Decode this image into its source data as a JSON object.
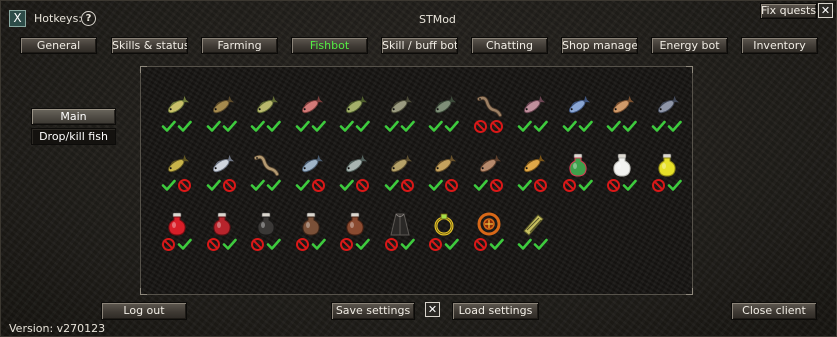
{
  "window": {
    "close_glyph": "X",
    "hotkeys_label": "Hotkeys:",
    "help_glyph": "?",
    "title": "STMod",
    "fix_quests_label": "Fix quests:",
    "fix_quests_close_glyph": "✕"
  },
  "tabs": [
    {
      "label": "General",
      "active": false
    },
    {
      "label": "Skills & status",
      "active": false
    },
    {
      "label": "Farming",
      "active": false
    },
    {
      "label": "Fishbot",
      "active": true
    },
    {
      "label": "Skill / buff bot",
      "active": false
    },
    {
      "label": "Chatting",
      "active": false
    },
    {
      "label": "Shop manager",
      "active": false
    },
    {
      "label": "Energy bot",
      "active": false
    },
    {
      "label": "Inventory",
      "active": false
    }
  ],
  "sidebar": {
    "main_label": "Main",
    "drop_kill_label": "Drop/kill fish"
  },
  "items": [
    {
      "icon": "fish-icon",
      "body": "#c9c06a",
      "accent": "#6e7a3a",
      "marks": [
        "check",
        "check"
      ]
    },
    {
      "icon": "fish-icon",
      "body": "#a58a4e",
      "accent": "#5b4a2a",
      "marks": [
        "check",
        "check"
      ]
    },
    {
      "icon": "fish-icon",
      "body": "#b9b86d",
      "accent": "#5f6a34",
      "marks": [
        "check",
        "check"
      ]
    },
    {
      "icon": "fish-icon",
      "body": "#d27a78",
      "accent": "#7a3c3a",
      "marks": [
        "check",
        "check"
      ]
    },
    {
      "icon": "fish-icon",
      "body": "#a3b06a",
      "accent": "#4f5f2e",
      "marks": [
        "check",
        "check"
      ]
    },
    {
      "icon": "fish-icon",
      "body": "#9a9a80",
      "accent": "#4b4b38",
      "marks": [
        "check",
        "check"
      ]
    },
    {
      "icon": "fish-icon",
      "body": "#7f8f78",
      "accent": "#3c4a3a",
      "marks": [
        "check",
        "check"
      ]
    },
    {
      "icon": "eel-icon",
      "body": "#9c8064",
      "accent": "#4f3c2c",
      "marks": [
        "ban",
        "ban"
      ]
    },
    {
      "icon": "fish-icon",
      "body": "#c08f9c",
      "accent": "#6a4452",
      "marks": [
        "check",
        "check"
      ]
    },
    {
      "icon": "fish-icon",
      "body": "#8aa6d4",
      "accent": "#3f557e",
      "marks": [
        "check",
        "check"
      ]
    },
    {
      "icon": "fish-icon",
      "body": "#d09a6a",
      "accent": "#7a5030",
      "marks": [
        "check",
        "check"
      ]
    },
    {
      "icon": "fish-icon",
      "body": "#8f96a8",
      "accent": "#414858",
      "marks": [
        "check",
        "check"
      ]
    },
    {
      "icon": "fish-icon",
      "body": "#c8b44a",
      "accent": "#5e5420",
      "marks": [
        "check",
        "ban"
      ]
    },
    {
      "icon": "fish-icon",
      "body": "#cfd4dc",
      "accent": "#6f7684",
      "marks": [
        "check",
        "ban"
      ]
    },
    {
      "icon": "eel-icon",
      "body": "#b49a72",
      "accent": "#5e4c34",
      "marks": [
        "check",
        "check"
      ]
    },
    {
      "icon": "fish-icon",
      "body": "#9fb4c8",
      "accent": "#4a5c70",
      "marks": [
        "check",
        "ban"
      ]
    },
    {
      "icon": "fish-icon",
      "body": "#a8b4b0",
      "accent": "#52605c",
      "marks": [
        "check",
        "ban"
      ]
    },
    {
      "icon": "fish-icon",
      "body": "#b6a268",
      "accent": "#5e5030",
      "marks": [
        "check",
        "ban"
      ]
    },
    {
      "icon": "fish-icon",
      "body": "#c4a25e",
      "accent": "#6a522a",
      "marks": [
        "check",
        "ban"
      ]
    },
    {
      "icon": "fish-icon",
      "body": "#b78a6c",
      "accent": "#5e3f2c",
      "marks": [
        "check",
        "ban"
      ]
    },
    {
      "icon": "fish-icon",
      "body": "#e0a848",
      "accent": "#7a5418",
      "marks": [
        "check",
        "ban"
      ]
    },
    {
      "icon": "potion-icon",
      "body": "#3ea04a",
      "accent": "#d23b52",
      "marks": [
        "ban",
        "check"
      ]
    },
    {
      "icon": "potion-icon",
      "body": "#f2f2f0",
      "accent": "#b9b9b4",
      "marks": [
        "ban",
        "check"
      ]
    },
    {
      "icon": "potion-icon",
      "body": "#e6e028",
      "accent": "#8c8414",
      "marks": [
        "ban",
        "check"
      ]
    },
    {
      "icon": "potion-icon",
      "body": "#d81e28",
      "accent": "#7a0c12",
      "marks": [
        "ban",
        "check"
      ]
    },
    {
      "icon": "potion-icon",
      "body": "#b8242c",
      "accent": "#5e1014",
      "marks": [
        "ban",
        "check"
      ]
    },
    {
      "icon": "potion-icon",
      "body": "#3a3836",
      "accent": "#1a1918",
      "marks": [
        "ban",
        "check"
      ]
    },
    {
      "icon": "potion-icon",
      "body": "#7a5038",
      "accent": "#3a2418",
      "marks": [
        "ban",
        "check"
      ]
    },
    {
      "icon": "potion-icon",
      "body": "#8a4a30",
      "accent": "#4a2214",
      "marks": [
        "ban",
        "check"
      ]
    },
    {
      "icon": "cloak-icon",
      "body": "#2a2826",
      "accent": "#5c5854",
      "marks": [
        "ban",
        "check"
      ]
    },
    {
      "icon": "ring-icon",
      "body": "#e6c428",
      "accent": "#6c5a10",
      "marks": [
        "ban",
        "check"
      ]
    },
    {
      "icon": "amulet-icon",
      "body": "#d86818",
      "accent": "#8a2a08",
      "marks": [
        "ban",
        "check"
      ]
    },
    {
      "icon": "bracelet-icon",
      "body": "#c8c060",
      "accent": "#5a5828",
      "marks": [
        "check",
        "check"
      ]
    }
  ],
  "footer": {
    "logout_label": "Log out",
    "save_label": "Save settings",
    "checkbox_glyph": "✕",
    "load_label": "Load settings",
    "close_client_label": "Close client",
    "version": "Version: v270123"
  },
  "colors": {
    "active_tab_text": "#55ee44",
    "check": "#3ecb3e",
    "ban": "#d81818"
  }
}
